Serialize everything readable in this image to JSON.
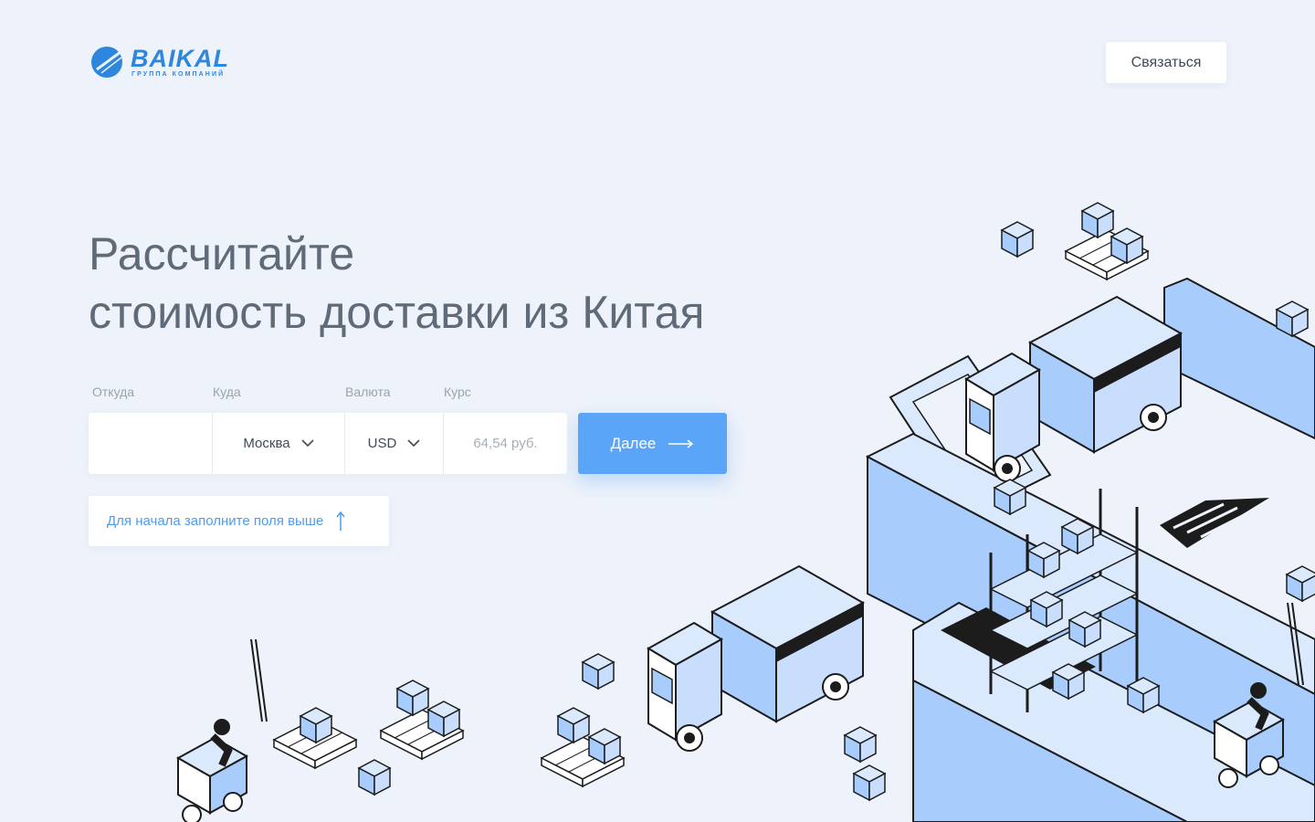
{
  "brand": {
    "name": "BAIKAL",
    "tagline": "ГРУППА КОМПАНИЙ",
    "color": "#2f86dd"
  },
  "header": {
    "contact_label": "Связаться"
  },
  "hero": {
    "line1": "Рассчитайте",
    "line2": "стоимость доставки из Китая"
  },
  "form": {
    "from_label": "Откуда",
    "from_value": "",
    "to_label": "Куда",
    "to_value": "Москва",
    "currency_label": "Валюта",
    "currency_value": "USD",
    "rate_label": "Курс",
    "rate_value": "64,54 руб.",
    "next_label": "Далее"
  },
  "hint": {
    "text": "Для начала заполните поля выше"
  },
  "colors": {
    "background": "#eef2fa",
    "accent": "#5aa5f7",
    "illustration_fill": "#a8ccfb",
    "illustration_light": "#dbe9fd",
    "outline": "#1c1c1c"
  }
}
